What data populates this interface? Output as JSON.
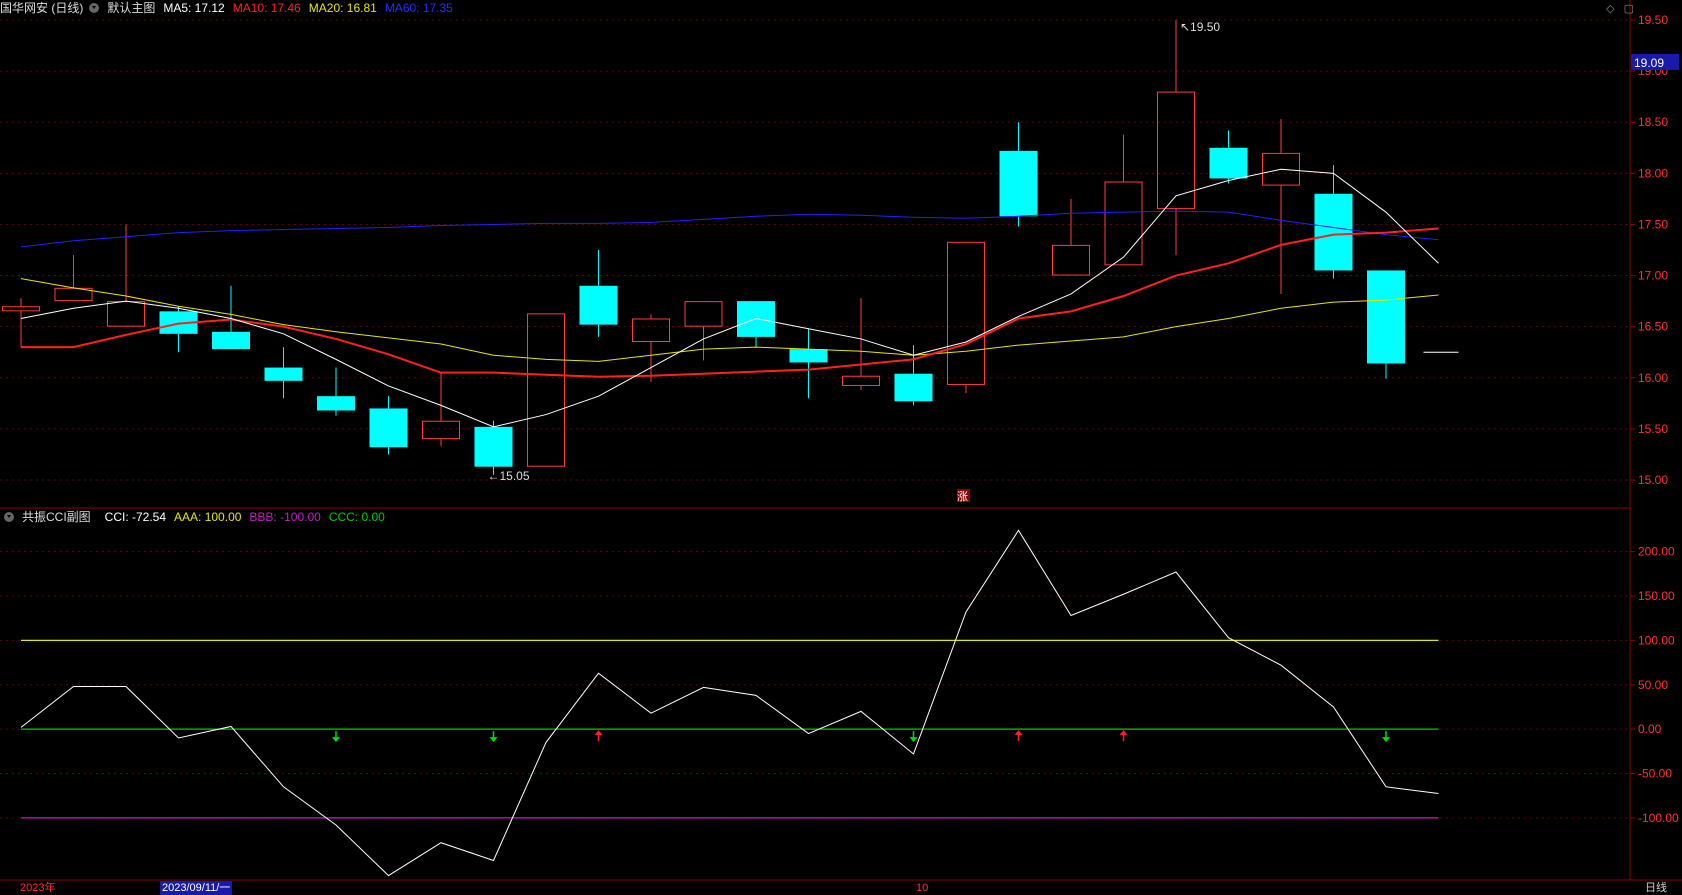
{
  "main_header": {
    "stock_title": "国华网安 (日线)",
    "template_label": "默认主图",
    "ma5": "MA5: 17.12",
    "ma10": "MA10: 17.46",
    "ma20": "MA20: 16.81",
    "ma60": "MA60: 17.35"
  },
  "sub_header": {
    "title": "共振CCI副图",
    "cci": "CCI: -72.54",
    "aaa": "AAA: 100.00",
    "bbb": "BBB: -100.00",
    "ccc": "CCC: 0.00"
  },
  "top_icons": [
    "diamond-icon",
    "window-icon"
  ],
  "price_axis": {
    "ticks": [
      "19.50",
      "19.00",
      "18.50",
      "18.00",
      "17.50",
      "17.00",
      "16.50",
      "16.00",
      "15.50",
      "15.00"
    ],
    "current_price": "19.09"
  },
  "cci_axis": {
    "ticks": [
      "200.00",
      "150.00",
      "100.00",
      "50.00",
      "0.00",
      "-50.00",
      "-100.00"
    ]
  },
  "price_annotations": {
    "high": "19.50",
    "low": "15.05"
  },
  "rise_marker": "涨",
  "bottom_bar": {
    "year": "2023年",
    "cursor_date": "2023/09/11/一",
    "month": "10",
    "period": "日线"
  },
  "colors": {
    "up": "#ff3b3b",
    "down": "#00ffff",
    "ma5": "#ffffff",
    "ma10": "#ff2020",
    "ma20": "#e6e600",
    "ma60": "#2020ff",
    "grid": "#8b0000",
    "cci_line": "#ffffff",
    "aaa": "#e6e600",
    "bbb": "#c020c0",
    "ccc": "#00cc00"
  },
  "chart_data": {
    "type": "candlestick",
    "price_range": [
      15.0,
      19.5
    ],
    "candles": [
      {
        "o": 16.65,
        "c": 16.7,
        "h": 16.78,
        "l": 16.3
      },
      {
        "o": 16.75,
        "c": 16.88,
        "h": 17.2,
        "l": 16.75
      },
      {
        "o": 16.5,
        "c": 16.75,
        "h": 17.5,
        "l": 16.5
      },
      {
        "o": 16.65,
        "c": 16.43,
        "h": 16.7,
        "l": 16.25
      },
      {
        "o": 16.45,
        "c": 16.28,
        "h": 16.9,
        "l": 16.28
      },
      {
        "o": 16.1,
        "c": 15.97,
        "h": 16.3,
        "l": 15.8
      },
      {
        "o": 15.82,
        "c": 15.68,
        "h": 16.1,
        "l": 15.63
      },
      {
        "o": 15.7,
        "c": 15.32,
        "h": 15.82,
        "l": 15.25
      },
      {
        "o": 15.4,
        "c": 15.58,
        "h": 16.05,
        "l": 15.33
      },
      {
        "o": 15.52,
        "c": 15.13,
        "h": 15.58,
        "l": 15.05
      },
      {
        "o": 15.13,
        "c": 16.63,
        "h": 16.63,
        "l": 15.13
      },
      {
        "o": 16.9,
        "c": 16.52,
        "h": 17.25,
        "l": 16.4
      },
      {
        "o": 16.35,
        "c": 16.58,
        "h": 16.62,
        "l": 15.96
      },
      {
        "o": 16.5,
        "c": 16.75,
        "h": 16.75,
        "l": 16.17
      },
      {
        "o": 16.75,
        "c": 16.4,
        "h": 16.75,
        "l": 16.3
      },
      {
        "o": 16.28,
        "c": 16.15,
        "h": 16.48,
        "l": 15.8
      },
      {
        "o": 15.92,
        "c": 16.02,
        "h": 16.78,
        "l": 15.88
      },
      {
        "o": 16.04,
        "c": 15.77,
        "h": 16.32,
        "l": 15.73
      },
      {
        "o": 15.93,
        "c": 17.33,
        "h": 17.33,
        "l": 15.85
      },
      {
        "o": 18.22,
        "c": 17.58,
        "h": 18.5,
        "l": 17.48
      },
      {
        "o": 17.0,
        "c": 17.3,
        "h": 17.75,
        "l": 17.0
      },
      {
        "o": 17.1,
        "c": 17.92,
        "h": 18.38,
        "l": 17.1
      },
      {
        "o": 17.65,
        "c": 18.8,
        "h": 19.5,
        "l": 17.2
      },
      {
        "o": 18.25,
        "c": 17.95,
        "h": 18.42,
        "l": 17.9
      },
      {
        "o": 17.88,
        "c": 18.2,
        "h": 18.53,
        "l": 16.82
      },
      {
        "o": 17.8,
        "c": 17.05,
        "h": 18.08,
        "l": 16.97
      },
      {
        "o": 17.05,
        "c": 16.14,
        "h": 17.05,
        "l": 15.99
      }
    ],
    "ma5": [
      16.58,
      16.68,
      16.75,
      16.68,
      16.58,
      16.43,
      16.18,
      15.92,
      15.73,
      15.52,
      15.64,
      15.82,
      16.1,
      16.38,
      16.58,
      16.48,
      16.38,
      16.22,
      16.35,
      16.6,
      16.82,
      17.18,
      17.78,
      17.93,
      18.04,
      18.0,
      17.62,
      17.12
    ],
    "ma10": [
      16.3,
      16.3,
      16.42,
      16.53,
      16.57,
      16.5,
      16.38,
      16.23,
      16.05,
      16.05,
      16.03,
      16.01,
      16.02,
      16.04,
      16.06,
      16.08,
      16.13,
      16.18,
      16.33,
      16.58,
      16.65,
      16.8,
      17.0,
      17.12,
      17.3,
      17.4,
      17.42,
      17.46
    ],
    "ma20": [
      16.97,
      16.88,
      16.8,
      16.7,
      16.62,
      16.52,
      16.45,
      16.39,
      16.33,
      16.22,
      16.18,
      16.16,
      16.22,
      16.28,
      16.3,
      16.28,
      16.26,
      16.22,
      16.26,
      16.32,
      16.36,
      16.4,
      16.5,
      16.58,
      16.68,
      16.74,
      16.76,
      16.81
    ],
    "ma60": [
      17.28,
      17.34,
      17.38,
      17.42,
      17.44,
      17.45,
      17.46,
      17.47,
      17.49,
      17.5,
      17.51,
      17.51,
      17.52,
      17.55,
      17.58,
      17.6,
      17.59,
      17.57,
      17.56,
      17.58,
      17.61,
      17.62,
      17.63,
      17.62,
      17.54,
      17.47,
      17.4,
      17.35
    ],
    "last_price_marker": 16.25,
    "cci_range": [
      -170,
      230
    ],
    "cci": [
      2,
      48,
      48,
      -10,
      3,
      -65,
      -108,
      -165,
      -128,
      -148,
      -15,
      63,
      18,
      47,
      38,
      -5,
      20,
      -28,
      132,
      224,
      128,
      152,
      177,
      103,
      72,
      25,
      -65,
      -72.54
    ],
    "aaa": 100,
    "bbb": -100,
    "ccc": 0,
    "signals": [
      {
        "i": 6,
        "dir": "down"
      },
      {
        "i": 9,
        "dir": "down"
      },
      {
        "i": 11,
        "dir": "up"
      },
      {
        "i": 17,
        "dir": "down"
      },
      {
        "i": 19,
        "dir": "up"
      },
      {
        "i": 21,
        "dir": "up"
      },
      {
        "i": 26,
        "dir": "down"
      }
    ]
  }
}
